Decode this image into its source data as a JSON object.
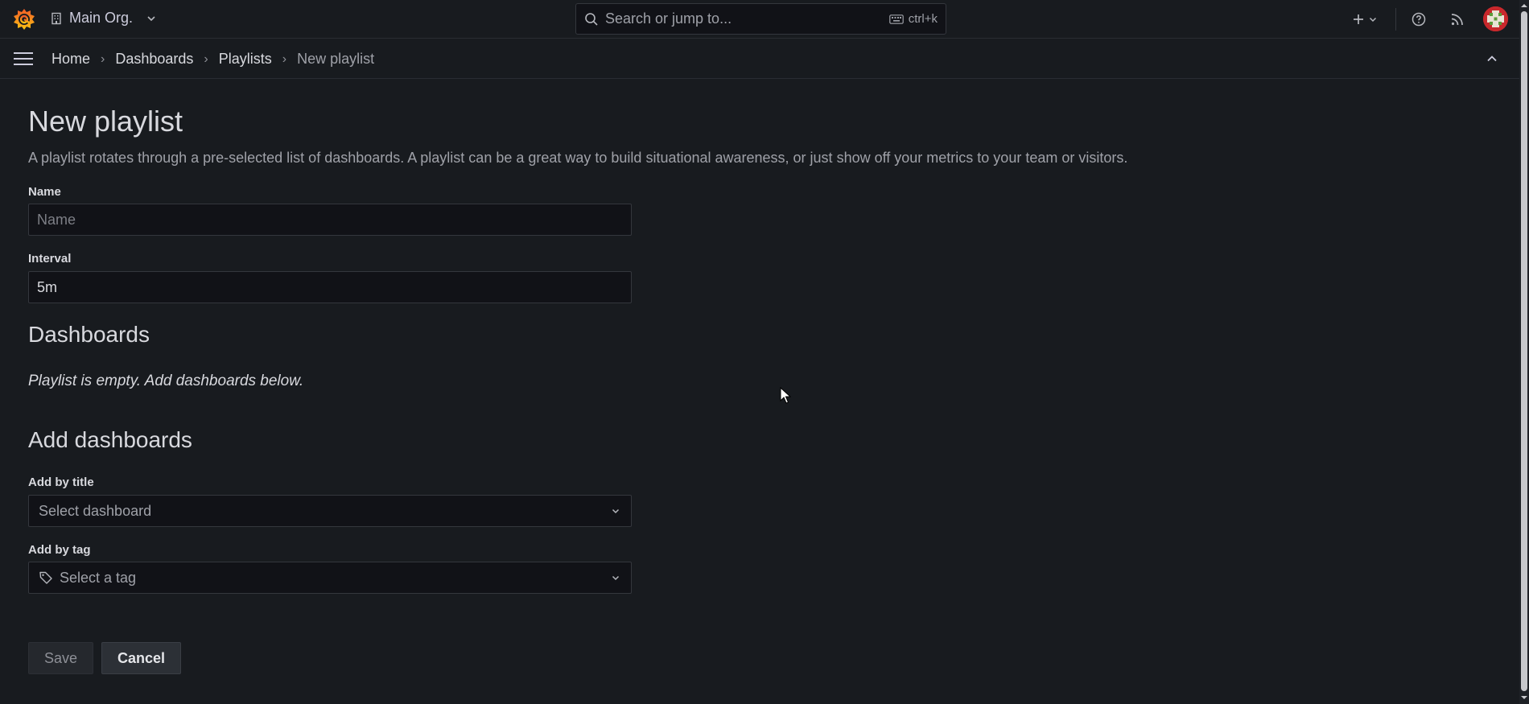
{
  "topbar": {
    "org_name": "Main Org.",
    "search_placeholder": "Search or jump to...",
    "search_shortcut": "ctrl+k"
  },
  "breadcrumbs": [
    {
      "label": "Home"
    },
    {
      "label": "Dashboards"
    },
    {
      "label": "Playlists"
    },
    {
      "label": "New playlist"
    }
  ],
  "page": {
    "title": "New playlist",
    "description": "A playlist rotates through a pre-selected list of dashboards. A playlist can be a great way to build situational awareness, or just show off your metrics to your team or visitors."
  },
  "form": {
    "name_label": "Name",
    "name_placeholder": "Name",
    "name_value": "",
    "interval_label": "Interval",
    "interval_value": "5m",
    "dashboards_heading": "Dashboards",
    "empty_message": "Playlist is empty. Add dashboards below.",
    "add_heading": "Add dashboards",
    "add_by_title_label": "Add by title",
    "add_by_title_placeholder": "Select dashboard",
    "add_by_tag_label": "Add by tag",
    "add_by_tag_placeholder": "Select a tag",
    "save_label": "Save",
    "cancel_label": "Cancel"
  },
  "colors": {
    "background": "#181b1f",
    "input_bg": "#111217",
    "border": "#34373d",
    "brand_orange": "#f46800",
    "brand_yellow": "#fbc313"
  },
  "icons": [
    "grafana-logo-icon",
    "building-icon",
    "chevron-down-icon",
    "search-icon",
    "keyboard-icon",
    "plus-icon",
    "help-icon",
    "rss-icon",
    "avatar",
    "hamburger-icon",
    "chevron-up-icon",
    "tag-icon"
  ]
}
